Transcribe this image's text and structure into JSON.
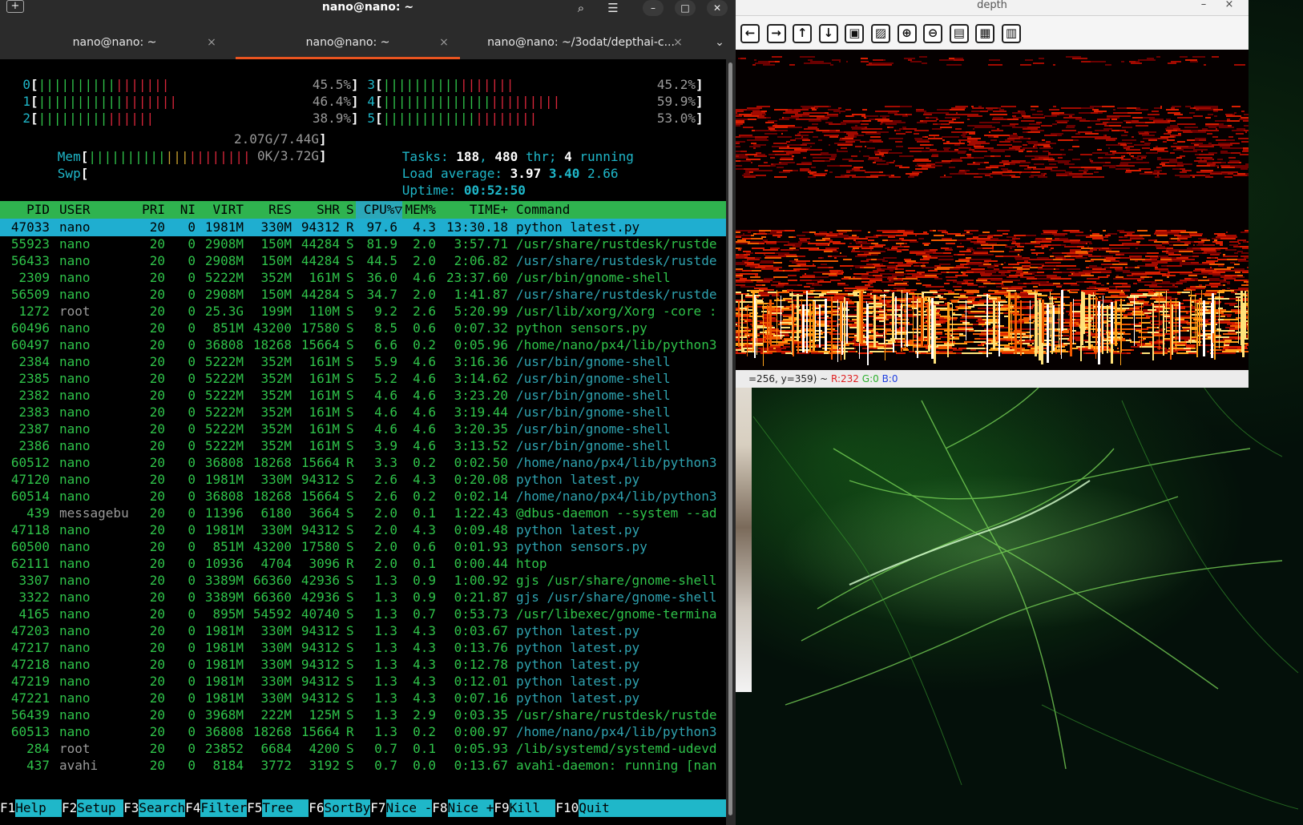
{
  "terminal": {
    "title": "nano@nano: ~",
    "icons": {
      "new_tab": "new-tab-icon",
      "search": "search-icon",
      "menu": "hamburger-menu-icon",
      "minimize": "minimize-icon",
      "maximize": "maximize-icon",
      "close": "close-icon"
    },
    "tabs": [
      {
        "label": "nano@nano: ~",
        "active": false
      },
      {
        "label": "nano@nano: ~",
        "active": true
      },
      {
        "label": "nano@nano: ~/3odat/depthai-c...",
        "active": false
      }
    ],
    "tab_close_glyph": "×",
    "tabs_dropdown_glyph": "⌄"
  },
  "htop": {
    "cpus": [
      {
        "id": "0",
        "pct": "45.5%",
        "fill": 0.455
      },
      {
        "id": "1",
        "pct": "46.4%",
        "fill": 0.464
      },
      {
        "id": "2",
        "pct": "38.9%",
        "fill": 0.389
      },
      {
        "id": "3",
        "pct": "45.2%",
        "fill": 0.452
      },
      {
        "id": "4",
        "pct": "59.9%",
        "fill": 0.599
      },
      {
        "id": "5",
        "pct": "53.0%",
        "fill": 0.53
      }
    ],
    "mem": {
      "label": "Mem",
      "value": "2.07G/7.44G"
    },
    "swp": {
      "label": "Swp",
      "value": "0K/3.72G"
    },
    "tasks": {
      "label": "Tasks:",
      "count": "188",
      "thr": "480",
      "thr_label": "thr;",
      "running": "4",
      "running_label": "running"
    },
    "load": {
      "label": "Load average:",
      "v1": "3.97",
      "v2": "3.40",
      "v3": "2.66"
    },
    "uptime": {
      "label": "Uptime:",
      "value": "00:52:50"
    },
    "columns": [
      "PID",
      "USER",
      "PRI",
      "NI",
      "VIRT",
      "RES",
      "SHR",
      "S",
      "CPU%▽",
      "MEM%",
      "TIME+",
      "Command"
    ],
    "processes": [
      {
        "pid": "47033",
        "user": "nano",
        "pri": "20",
        "ni": "0",
        "virt": "1981M",
        "res": "330M",
        "shr": "94312",
        "s": "R",
        "cpu": "97.6",
        "mem": "4.3",
        "time": "13:30.18",
        "cmd": "python latest.py",
        "selected": true
      },
      {
        "pid": "55923",
        "user": "nano",
        "pri": "20",
        "ni": "0",
        "virt": "2908M",
        "res": "150M",
        "shr": "44284",
        "s": "S",
        "cpu": "81.9",
        "mem": "2.0",
        "time": "3:57.71",
        "cmd": "/usr/share/rustdesk/rustde"
      },
      {
        "pid": "56433",
        "user": "nano",
        "pri": "20",
        "ni": "0",
        "virt": "2908M",
        "res": "150M",
        "shr": "44284",
        "s": "S",
        "cpu": "44.5",
        "mem": "2.0",
        "time": "2:06.82",
        "cmd": "/usr/share/rustdesk/rustde",
        "thread": true
      },
      {
        "pid": "2309",
        "user": "nano",
        "pri": "20",
        "ni": "0",
        "virt": "5222M",
        "res": "352M",
        "shr": "161M",
        "s": "S",
        "cpu": "36.0",
        "mem": "4.6",
        "time": "23:37.60",
        "cmd": "/usr/bin/gnome-shell"
      },
      {
        "pid": "56509",
        "user": "nano",
        "pri": "20",
        "ni": "0",
        "virt": "2908M",
        "res": "150M",
        "shr": "44284",
        "s": "S",
        "cpu": "34.7",
        "mem": "2.0",
        "time": "1:41.87",
        "cmd": "/usr/share/rustdesk/rustde",
        "thread": true
      },
      {
        "pid": "1272",
        "user": "root",
        "pri": "20",
        "ni": "0",
        "virt": "25.3G",
        "res": "199M",
        "shr": "110M",
        "s": "S",
        "cpu": "9.2",
        "mem": "2.6",
        "time": "5:20.99",
        "cmd": "/usr/lib/xorg/Xorg -core :",
        "dimuser": true
      },
      {
        "pid": "60496",
        "user": "nano",
        "pri": "20",
        "ni": "0",
        "virt": "851M",
        "res": "43200",
        "shr": "17580",
        "s": "S",
        "cpu": "8.5",
        "mem": "0.6",
        "time": "0:07.32",
        "cmd": "python sensors.py"
      },
      {
        "pid": "60497",
        "user": "nano",
        "pri": "20",
        "ni": "0",
        "virt": "36808",
        "res": "18268",
        "shr": "15664",
        "s": "S",
        "cpu": "6.6",
        "mem": "0.2",
        "time": "0:05.96",
        "cmd": "/home/nano/px4/lib/python3"
      },
      {
        "pid": "2384",
        "user": "nano",
        "pri": "20",
        "ni": "0",
        "virt": "5222M",
        "res": "352M",
        "shr": "161M",
        "s": "S",
        "cpu": "5.9",
        "mem": "4.6",
        "time": "3:16.36",
        "cmd": "/usr/bin/gnome-shell",
        "thread": true
      },
      {
        "pid": "2385",
        "user": "nano",
        "pri": "20",
        "ni": "0",
        "virt": "5222M",
        "res": "352M",
        "shr": "161M",
        "s": "S",
        "cpu": "5.2",
        "mem": "4.6",
        "time": "3:14.62",
        "cmd": "/usr/bin/gnome-shell",
        "thread": true
      },
      {
        "pid": "2382",
        "user": "nano",
        "pri": "20",
        "ni": "0",
        "virt": "5222M",
        "res": "352M",
        "shr": "161M",
        "s": "S",
        "cpu": "4.6",
        "mem": "4.6",
        "time": "3:23.20",
        "cmd": "/usr/bin/gnome-shell",
        "thread": true
      },
      {
        "pid": "2383",
        "user": "nano",
        "pri": "20",
        "ni": "0",
        "virt": "5222M",
        "res": "352M",
        "shr": "161M",
        "s": "S",
        "cpu": "4.6",
        "mem": "4.6",
        "time": "3:19.44",
        "cmd": "/usr/bin/gnome-shell",
        "thread": true
      },
      {
        "pid": "2387",
        "user": "nano",
        "pri": "20",
        "ni": "0",
        "virt": "5222M",
        "res": "352M",
        "shr": "161M",
        "s": "S",
        "cpu": "4.6",
        "mem": "4.6",
        "time": "3:20.35",
        "cmd": "/usr/bin/gnome-shell",
        "thread": true
      },
      {
        "pid": "2386",
        "user": "nano",
        "pri": "20",
        "ni": "0",
        "virt": "5222M",
        "res": "352M",
        "shr": "161M",
        "s": "S",
        "cpu": "3.9",
        "mem": "4.6",
        "time": "3:13.52",
        "cmd": "/usr/bin/gnome-shell",
        "thread": true
      },
      {
        "pid": "60512",
        "user": "nano",
        "pri": "20",
        "ni": "0",
        "virt": "36808",
        "res": "18268",
        "shr": "15664",
        "s": "R",
        "cpu": "3.3",
        "mem": "0.2",
        "time": "0:02.50",
        "cmd": "/home/nano/px4/lib/python3",
        "thread": true
      },
      {
        "pid": "47120",
        "user": "nano",
        "pri": "20",
        "ni": "0",
        "virt": "1981M",
        "res": "330M",
        "shr": "94312",
        "s": "S",
        "cpu": "2.6",
        "mem": "4.3",
        "time": "0:20.08",
        "cmd": "python latest.py",
        "thread": true
      },
      {
        "pid": "60514",
        "user": "nano",
        "pri": "20",
        "ni": "0",
        "virt": "36808",
        "res": "18268",
        "shr": "15664",
        "s": "S",
        "cpu": "2.6",
        "mem": "0.2",
        "time": "0:02.14",
        "cmd": "/home/nano/px4/lib/python3",
        "thread": true
      },
      {
        "pid": "439",
        "user": "messagebu",
        "pri": "20",
        "ni": "0",
        "virt": "11396",
        "res": "6180",
        "shr": "3664",
        "s": "S",
        "cpu": "2.0",
        "mem": "0.1",
        "time": "1:22.43",
        "cmd": "@dbus-daemon --system --ad",
        "dimuser": true
      },
      {
        "pid": "47118",
        "user": "nano",
        "pri": "20",
        "ni": "0",
        "virt": "1981M",
        "res": "330M",
        "shr": "94312",
        "s": "S",
        "cpu": "2.0",
        "mem": "4.3",
        "time": "0:09.48",
        "cmd": "python latest.py",
        "thread": true
      },
      {
        "pid": "60500",
        "user": "nano",
        "pri": "20",
        "ni": "0",
        "virt": "851M",
        "res": "43200",
        "shr": "17580",
        "s": "S",
        "cpu": "2.0",
        "mem": "0.6",
        "time": "0:01.93",
        "cmd": "python sensors.py",
        "thread": true
      },
      {
        "pid": "62111",
        "user": "nano",
        "pri": "20",
        "ni": "0",
        "virt": "10936",
        "res": "4704",
        "shr": "3096",
        "s": "R",
        "cpu": "2.0",
        "mem": "0.1",
        "time": "0:00.44",
        "cmd": "htop"
      },
      {
        "pid": "3307",
        "user": "nano",
        "pri": "20",
        "ni": "0",
        "virt": "3389M",
        "res": "66360",
        "shr": "42936",
        "s": "S",
        "cpu": "1.3",
        "mem": "0.9",
        "time": "1:00.92",
        "cmd": "gjs /usr/share/gnome-shell"
      },
      {
        "pid": "3322",
        "user": "nano",
        "pri": "20",
        "ni": "0",
        "virt": "3389M",
        "res": "66360",
        "shr": "42936",
        "s": "S",
        "cpu": "1.3",
        "mem": "0.9",
        "time": "0:21.87",
        "cmd": "gjs /usr/share/gnome-shell",
        "thread": true
      },
      {
        "pid": "4165",
        "user": "nano",
        "pri": "20",
        "ni": "0",
        "virt": "895M",
        "res": "54592",
        "shr": "40740",
        "s": "S",
        "cpu": "1.3",
        "mem": "0.7",
        "time": "0:53.73",
        "cmd": "/usr/libexec/gnome-termina"
      },
      {
        "pid": "47203",
        "user": "nano",
        "pri": "20",
        "ni": "0",
        "virt": "1981M",
        "res": "330M",
        "shr": "94312",
        "s": "S",
        "cpu": "1.3",
        "mem": "4.3",
        "time": "0:03.67",
        "cmd": "python latest.py",
        "thread": true
      },
      {
        "pid": "47217",
        "user": "nano",
        "pri": "20",
        "ni": "0",
        "virt": "1981M",
        "res": "330M",
        "shr": "94312",
        "s": "S",
        "cpu": "1.3",
        "mem": "4.3",
        "time": "0:13.76",
        "cmd": "python latest.py",
        "thread": true
      },
      {
        "pid": "47218",
        "user": "nano",
        "pri": "20",
        "ni": "0",
        "virt": "1981M",
        "res": "330M",
        "shr": "94312",
        "s": "S",
        "cpu": "1.3",
        "mem": "4.3",
        "time": "0:12.78",
        "cmd": "python latest.py",
        "thread": true
      },
      {
        "pid": "47219",
        "user": "nano",
        "pri": "20",
        "ni": "0",
        "virt": "1981M",
        "res": "330M",
        "shr": "94312",
        "s": "S",
        "cpu": "1.3",
        "mem": "4.3",
        "time": "0:12.01",
        "cmd": "python latest.py",
        "thread": true
      },
      {
        "pid": "47221",
        "user": "nano",
        "pri": "20",
        "ni": "0",
        "virt": "1981M",
        "res": "330M",
        "shr": "94312",
        "s": "S",
        "cpu": "1.3",
        "mem": "4.3",
        "time": "0:07.16",
        "cmd": "python latest.py",
        "thread": true
      },
      {
        "pid": "56439",
        "user": "nano",
        "pri": "20",
        "ni": "0",
        "virt": "3968M",
        "res": "222M",
        "shr": "125M",
        "s": "S",
        "cpu": "1.3",
        "mem": "2.9",
        "time": "0:03.35",
        "cmd": "/usr/share/rustdesk/rustde"
      },
      {
        "pid": "60513",
        "user": "nano",
        "pri": "20",
        "ni": "0",
        "virt": "36808",
        "res": "18268",
        "shr": "15664",
        "s": "R",
        "cpu": "1.3",
        "mem": "0.2",
        "time": "0:00.97",
        "cmd": "/home/nano/px4/lib/python3",
        "thread": true
      },
      {
        "pid": "284",
        "user": "root",
        "pri": "20",
        "ni": "0",
        "virt": "23852",
        "res": "6684",
        "shr": "4200",
        "s": "S",
        "cpu": "0.7",
        "mem": "0.1",
        "time": "0:05.93",
        "cmd": "/lib/systemd/systemd-udevd",
        "dimuser": true
      },
      {
        "pid": "437",
        "user": "avahi",
        "pri": "20",
        "ni": "0",
        "virt": "8184",
        "res": "3772",
        "shr": "3192",
        "s": "S",
        "cpu": "0.7",
        "mem": "0.0",
        "time": "0:13.67",
        "cmd": "avahi-daemon: running [nan",
        "dimuser": true
      }
    ],
    "fkeys": [
      {
        "key": "F1",
        "label": "Help  "
      },
      {
        "key": "F2",
        "label": "Setup "
      },
      {
        "key": "F3",
        "label": "Search"
      },
      {
        "key": "F4",
        "label": "Filter"
      },
      {
        "key": "F5",
        "label": "Tree  "
      },
      {
        "key": "F6",
        "label": "SortBy"
      },
      {
        "key": "F7",
        "label": "Nice -"
      },
      {
        "key": "F8",
        "label": "Nice +"
      },
      {
        "key": "F9",
        "label": "Kill  "
      },
      {
        "key": "F10",
        "label": "Quit  "
      }
    ]
  },
  "depth_window": {
    "title": "depth",
    "minimize_glyph": "–",
    "close_glyph": "×",
    "toolbar": [
      {
        "name": "back-icon",
        "glyph": "←"
      },
      {
        "name": "forward-icon",
        "glyph": "→"
      },
      {
        "name": "up-icon",
        "glyph": "↑"
      },
      {
        "name": "down-icon",
        "glyph": "↓"
      },
      {
        "name": "image-icon",
        "glyph": "▣"
      },
      {
        "name": "image-settings-icon",
        "glyph": "▨"
      },
      {
        "name": "zoom-in-icon",
        "glyph": "⊕"
      },
      {
        "name": "zoom-out-icon",
        "glyph": "⊖"
      },
      {
        "name": "save-icon",
        "glyph": "▤"
      },
      {
        "name": "clipboard-icon",
        "glyph": "▦"
      },
      {
        "name": "properties-icon",
        "glyph": "▥"
      }
    ],
    "status": {
      "coords": "=256, y=359) ~ ",
      "r": "R:232",
      "g": "G:0",
      "b": "B:0"
    }
  },
  "colors": {
    "htop_green": "#2fc34a",
    "htop_cyan": "#1fb7c9",
    "htop_red": "#d8263a",
    "header_green": "#2fb34f",
    "ubuntu_orange": "#e95420",
    "depth_hot": "#e81000"
  }
}
